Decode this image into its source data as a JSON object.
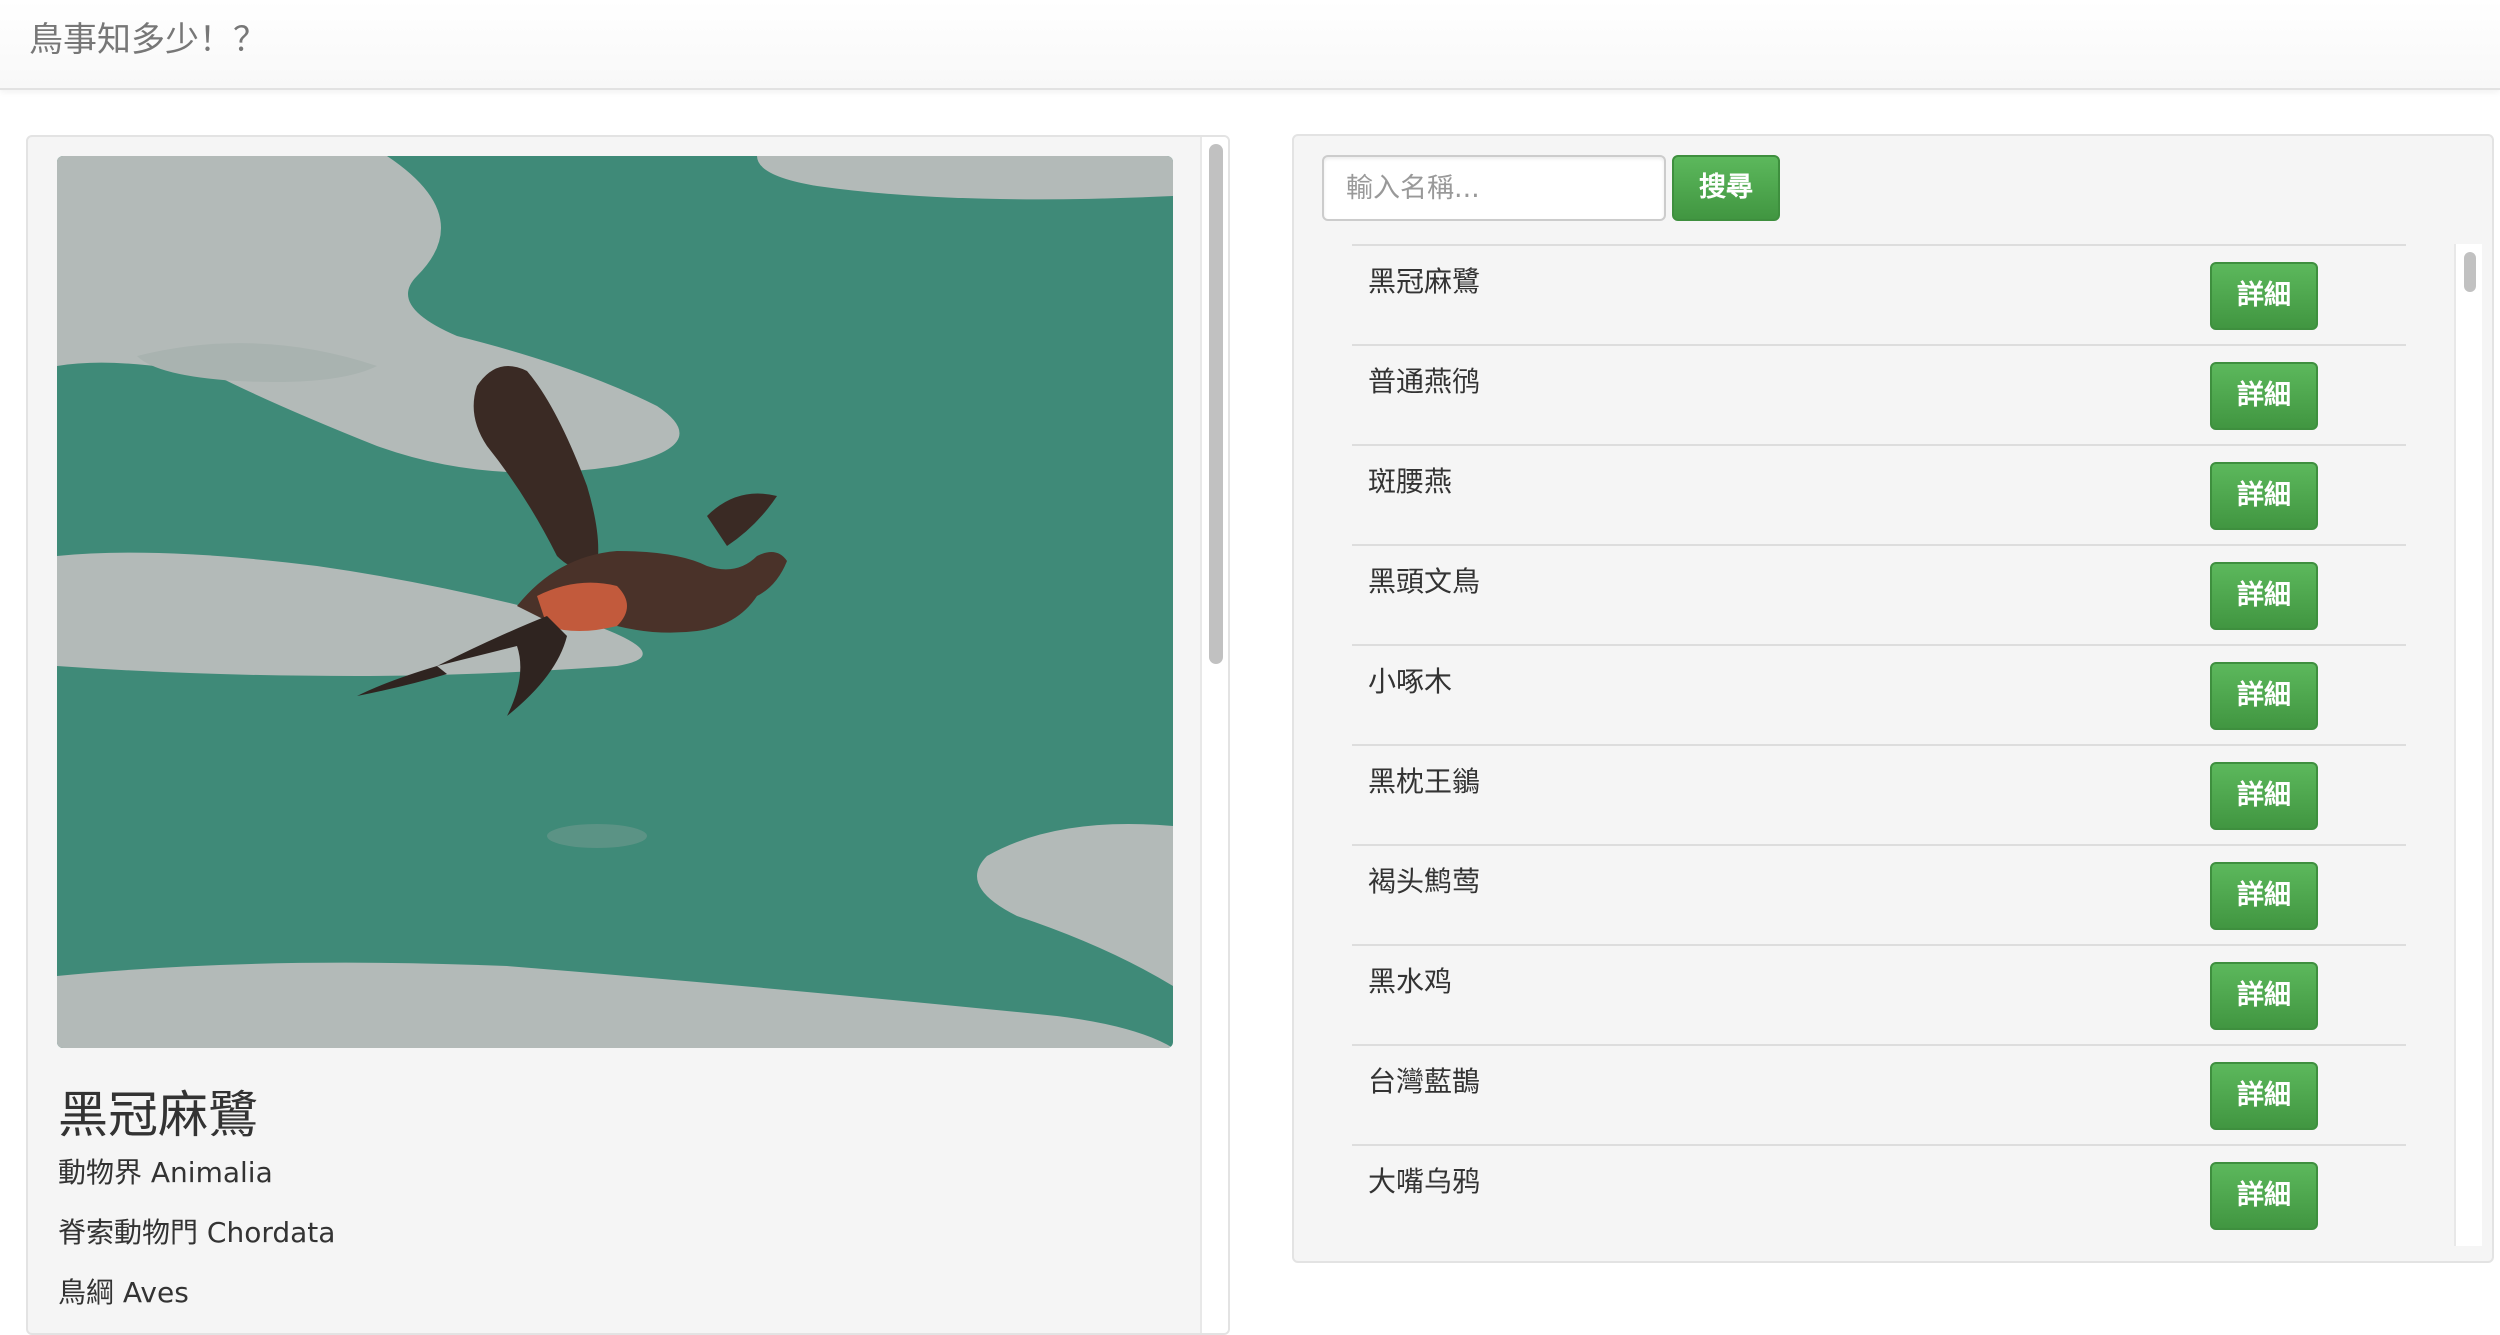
{
  "navbar": {
    "brand": "鳥事知多少！？"
  },
  "detail": {
    "photo_alt": "bird-photo",
    "name": "黑冠麻鷺",
    "taxonomy": [
      "動物界 Animalia",
      "脊索動物門 Chordata",
      "鳥綱 Aves"
    ]
  },
  "search": {
    "placeholder": "輸入名稱...",
    "button_label": "搜尋"
  },
  "birds": [
    {
      "name": "黑冠麻鷺",
      "button": "詳細"
    },
    {
      "name": "普通燕鸻",
      "button": "詳細"
    },
    {
      "name": "斑腰燕",
      "button": "詳細"
    },
    {
      "name": "黑頭文鳥",
      "button": "詳細"
    },
    {
      "name": "小啄木",
      "button": "詳細"
    },
    {
      "name": "黑枕王鶲",
      "button": "詳細"
    },
    {
      "name": "褐头鹪莺",
      "button": "詳細"
    },
    {
      "name": "黑水鸡",
      "button": "詳細"
    },
    {
      "name": "台灣藍鵲",
      "button": "詳細"
    },
    {
      "name": "大嘴乌鸦",
      "button": "詳細"
    }
  ],
  "colors": {
    "button_green": "#5cb85c",
    "panel_bg": "#f5f5f5",
    "water_green": "#3f8a78"
  }
}
